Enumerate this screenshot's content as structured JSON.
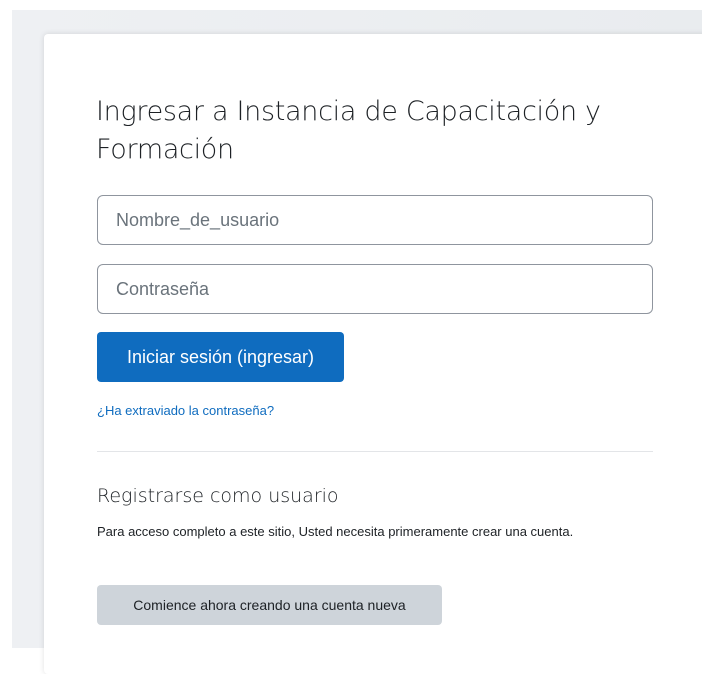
{
  "login": {
    "title": "Ingresar a Instancia de Capacitación y Formación",
    "username_placeholder": "Nombre_de_usuario",
    "password_placeholder": "Contraseña",
    "submit_label": "Iniciar sesión (ingresar)",
    "forgot_password_link": "¿Ha extraviado la contraseña?"
  },
  "signup": {
    "title": "Registrarse como usuario",
    "description": "Para acceso completo a este sitio, Usted necesita primeramente crear una cuenta.",
    "button_label": "Comience ahora creando una cuenta nueva"
  },
  "colors": {
    "primary": "#0f6cbf",
    "secondary_button": "#ced4da",
    "page_background": "#e9ecef",
    "text": "#1d2125"
  }
}
